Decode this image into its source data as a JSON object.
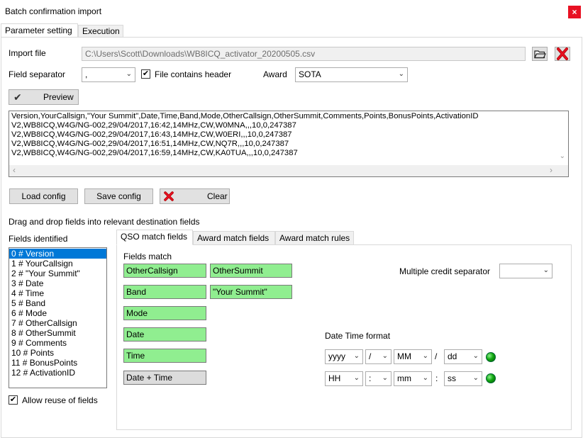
{
  "window": {
    "title": "Batch confirmation import",
    "close": "×"
  },
  "tabs": [
    {
      "label": "Parameter setting"
    },
    {
      "label": "Execution"
    }
  ],
  "import_file": {
    "label": "Import file",
    "value": "C:\\Users\\Scott\\Downloads\\WB8ICQ_activator_20200505.csv"
  },
  "field_separator": {
    "label": "Field separator",
    "value": ","
  },
  "header_checkbox": {
    "label": "File contains header",
    "checked": "✔"
  },
  "award": {
    "label": "Award",
    "value": "SOTA"
  },
  "preview": {
    "button_label": "Preview",
    "lines": [
      "Version,YourCallsign,\"Your Summit\",Date,Time,Band,Mode,OtherCallsign,OtherSummit,Comments,Points,BonusPoints,ActivationID",
      "V2,WB8ICQ,W4G/NG-002,29/04/2017,16:42,14MHz,CW,W0MNA,,,10,0,247387",
      "V2,WB8ICQ,W4G/NG-002,29/04/2017,16:43,14MHz,CW,W0ERI,,,10,0,247387",
      "V2,WB8ICQ,W4G/NG-002,29/04/2017,16:51,14MHz,CW,NQ7R,,,10,0,247387",
      "V2,WB8ICQ,W4G/NG-002,29/04/2017,16:59,14MHz,CW,KA0TUA,,,10,0,247387"
    ]
  },
  "config": {
    "load_label": "Load config",
    "save_label": "Save config",
    "clear_label": "Clear"
  },
  "drag_instruction": "Drag and drop fields into relevant destination fields",
  "fields_identified": {
    "label": "Fields identified",
    "items": [
      "0 # Version",
      "1 # YourCallsign",
      "2 # \"Your Summit\"",
      "3 # Date",
      "4 # Time",
      "5 # Band",
      "6 # Mode",
      "7 # OtherCallsign",
      "8 # OtherSummit",
      "9 # Comments",
      "10 # Points",
      "11 # BonusPoints",
      "12 # ActivationID"
    ],
    "selected_index": 0
  },
  "allow_reuse": {
    "label": "Allow reuse of fields",
    "checked": "✔"
  },
  "inner_tabs": [
    {
      "label": "QSO match fields"
    },
    {
      "label": "Award match fields"
    },
    {
      "label": "Award match rules"
    }
  ],
  "fields_match": {
    "label": "Fields match",
    "left": [
      "OtherCallsign",
      "Band",
      "Mode",
      "Date",
      "Time",
      "Date + Time"
    ],
    "right": [
      "OtherSummit",
      "\"Your Summit\""
    ]
  },
  "multiple_credit_separator": {
    "label": "Multiple credit separator",
    "value": ""
  },
  "datetime_format": {
    "label": "Date Time format",
    "date": {
      "part1": "yyyy",
      "sep1": "/",
      "part2": "MM",
      "sep_text": "/",
      "part3": "dd"
    },
    "time": {
      "part1": "HH",
      "sep1": ":",
      "part2": "mm",
      "sep_text": ":",
      "part3": "ss"
    }
  },
  "colors": {
    "accent": "#0078d7",
    "field_green": "#90ee90",
    "close_red": "#e81123",
    "status_led": "#11a811"
  }
}
